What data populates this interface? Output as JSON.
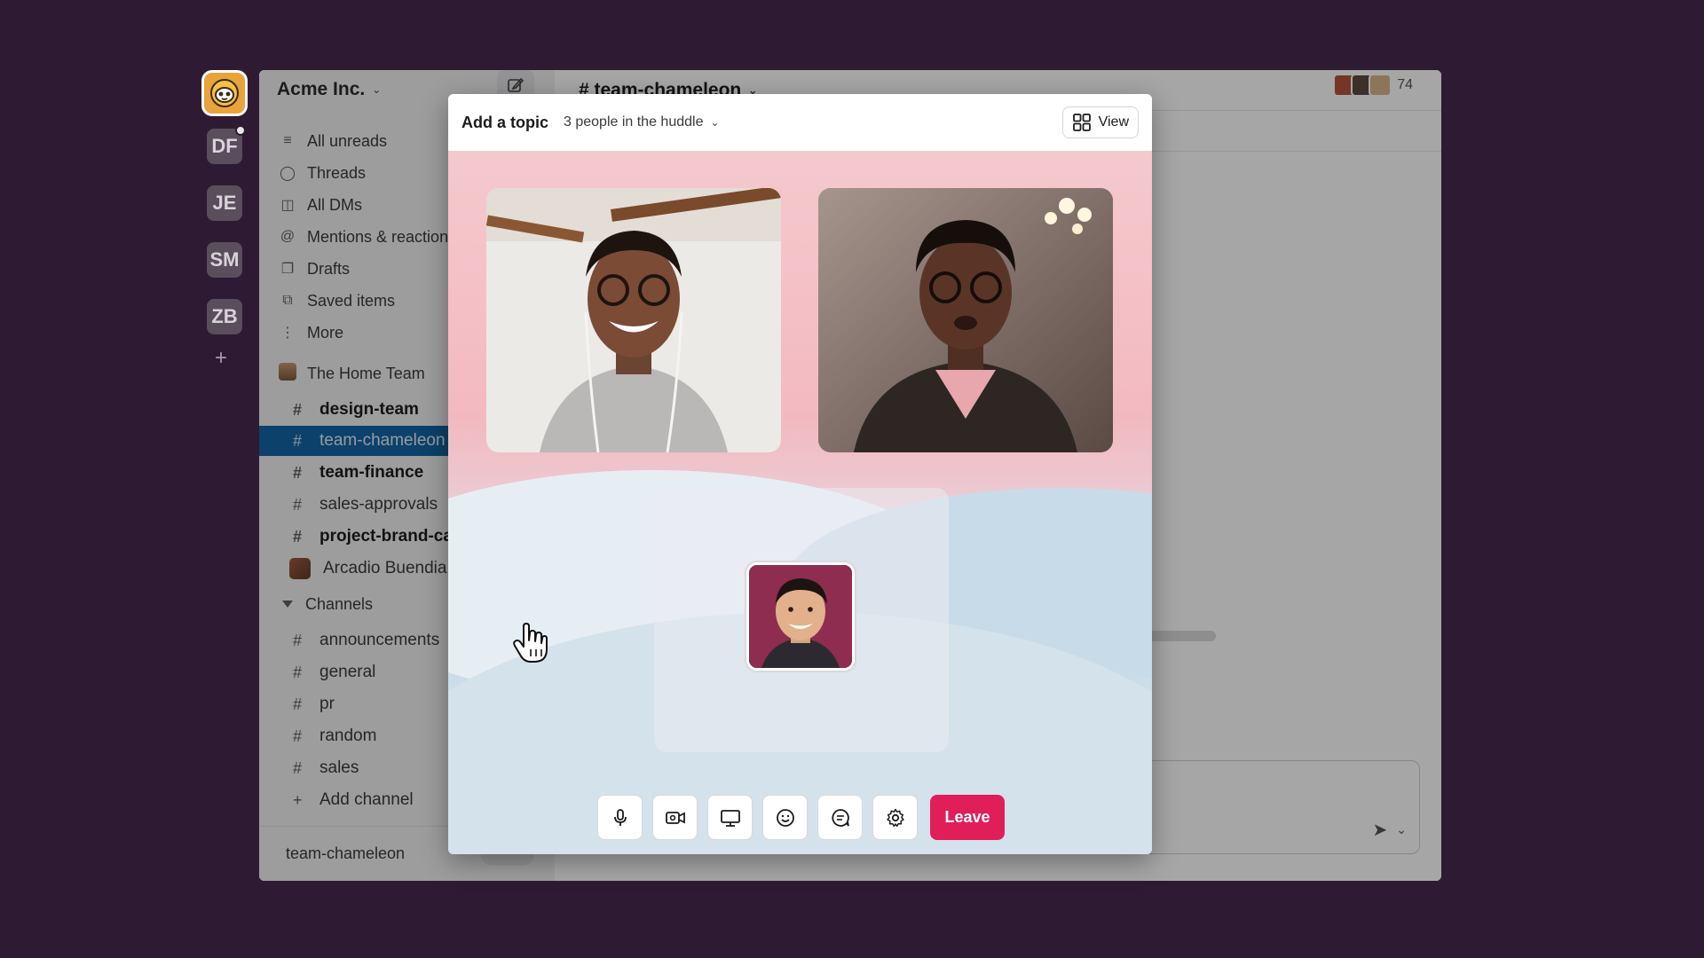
{
  "workspaces": {
    "items": [
      "DF",
      "JE",
      "SM",
      "ZB"
    ],
    "add_label": "+"
  },
  "sidebar": {
    "workspace_name": "Acme Inc.",
    "nav": [
      {
        "label": "All unreads",
        "icon": "lines-icon"
      },
      {
        "label": "Threads",
        "icon": "threads-icon"
      },
      {
        "label": "All DMs",
        "icon": "dms-icon"
      },
      {
        "label": "Mentions & reactions",
        "icon": "at-icon"
      },
      {
        "label": "Drafts",
        "icon": "drafts-icon"
      },
      {
        "label": "Saved items",
        "icon": "bookmark-icon"
      },
      {
        "label": "More",
        "icon": "more-vertical-icon"
      }
    ],
    "section_home": "The Home Team",
    "home_channels": [
      {
        "label": "design-team",
        "bold": true
      },
      {
        "label": "team-chameleon",
        "active": true
      },
      {
        "label": "team-finance",
        "bold": true
      },
      {
        "label": "sales-approvals"
      },
      {
        "label": "project-brand-campaign",
        "bold": true
      }
    ],
    "dm_label": "Arcadio Buendia",
    "section_channels": "Channels",
    "channels": [
      "announcements",
      "general",
      "pr",
      "random",
      "sales"
    ],
    "add_channel": "Add channel",
    "footer_channel": "team-chameleon"
  },
  "main": {
    "channel_title": "# team-chameleon",
    "member_count": "74"
  },
  "huddle": {
    "topic": "Add a topic",
    "people": "3 people in the huddle",
    "view_label": "View",
    "leave_label": "Leave",
    "controls": [
      "microphone-icon",
      "video-camera-icon",
      "screen-share-icon",
      "emoji-icon",
      "chat-icon",
      "settings-icon"
    ]
  },
  "colors": {
    "aubergine": "#2e1a33",
    "active_channel": "#1164a3",
    "leave_red": "#e01e5a"
  }
}
